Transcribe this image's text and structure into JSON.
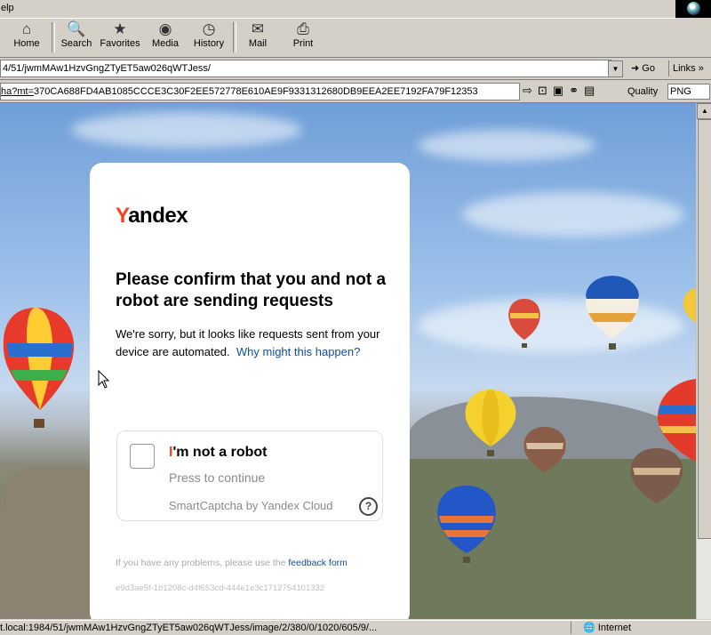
{
  "menubar": {
    "help": "elp"
  },
  "toolbar": {
    "home": "Home",
    "search": "Search",
    "favorites": "Favorites",
    "media": "Media",
    "history": "History",
    "mail": "Mail",
    "print": "Print"
  },
  "address": {
    "url": "4/51/jwmMAw1HzvGngZTyET5aw026qWTJess/",
    "go": "Go",
    "links": "Links"
  },
  "proxybar": {
    "url_prefix": "ha?mt=",
    "url_rest": "370CA688FD4AB1085CCCE3C30F2EE572778E610AE9F9331312680DB9EEA2EE7192FA79F12353",
    "quality_label": "Quality",
    "quality_value": "PNG"
  },
  "captcha_page": {
    "logo_y": "Y",
    "logo_rest": "andex",
    "heading": "Please confirm that you and not a robot are sending requests",
    "description": "We're sorry, but it looks like requests sent from your device are automated.",
    "why_link": "Why might this happen?",
    "checkbox_title_first": "I",
    "checkbox_title_rest": "'m not a robot",
    "press_to_continue": "Press to continue",
    "brand": "SmartCaptcha by Yandex Cloud",
    "help_icon": "?",
    "problems_text": "If you have any problems, please use the",
    "feedback_link": "feedback form",
    "request_id": "e9d3ae5f-1b1208c-d4f653cd-444e1e3c1712754101332"
  },
  "statusbar": {
    "text": "t.local:1984/51/jwmMAw1HzvGngZTyET5aw026qWTJess/image/2/380/0/1020/605/9/...",
    "zone": "Internet"
  },
  "colors": {
    "yandex_red": "#fc3f1d",
    "link_blue": "#0f4fa8",
    "chrome_gray": "#d4d0c8"
  }
}
